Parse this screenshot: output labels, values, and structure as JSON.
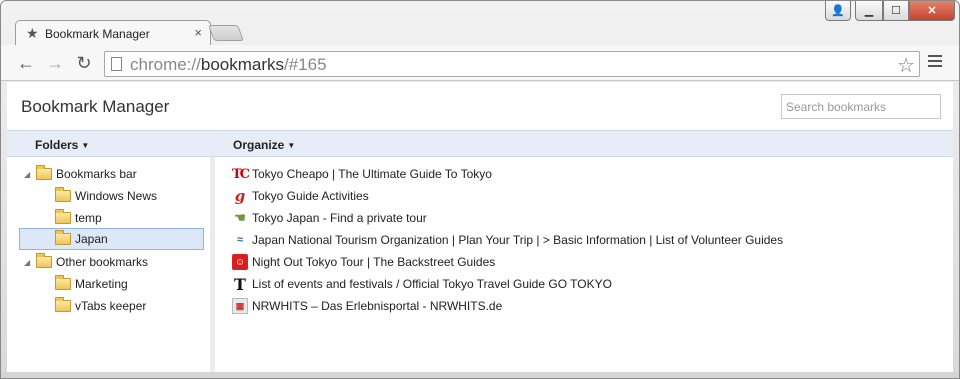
{
  "tab": {
    "title": "Bookmark Manager",
    "star_icon": "star-icon",
    "close": "×"
  },
  "window_controls": {
    "user": "👤",
    "minimize": "▁",
    "maximize": "☐",
    "close": "✕"
  },
  "toolbar": {
    "back": "←",
    "forward": "→",
    "reload": "↻"
  },
  "omnibox": {
    "scheme": "chrome://",
    "host": "bookmarks",
    "path": "/#165",
    "star": "☆"
  },
  "page": {
    "title": "Bookmark Manager",
    "search_placeholder": "Search bookmarks"
  },
  "bar": {
    "folders_label": "Folders",
    "organize_label": "Organize",
    "caret": "▼"
  },
  "tree": [
    {
      "label": "Bookmarks bar",
      "twisty": "◢",
      "level": 0
    },
    {
      "label": "Windows News",
      "twisty": "",
      "level": 1
    },
    {
      "label": "temp",
      "twisty": "",
      "level": 1
    },
    {
      "label": "Japan",
      "twisty": "",
      "level": 1,
      "selected": true
    },
    {
      "label": "Other bookmarks",
      "twisty": "◢",
      "level": 0
    },
    {
      "label": "Marketing",
      "twisty": "",
      "level": 1
    },
    {
      "label": "vTabs keeper",
      "twisty": "",
      "level": 1
    }
  ],
  "bookmarks": [
    {
      "icon": "tc",
      "icon_text": "TC",
      "title": "Tokyo Cheapo | The Ultimate Guide To Tokyo"
    },
    {
      "icon": "g",
      "icon_text": "g",
      "title": "Tokyo Guide Activities"
    },
    {
      "icon": "hand",
      "icon_text": "☚",
      "title": "Tokyo Japan - Find a private tour"
    },
    {
      "icon": "jnto",
      "icon_text": "≈",
      "title": "Japan National Tourism Organization | Plan Your Trip | > Basic Information | List of Volunteer Guides"
    },
    {
      "icon": "night",
      "icon_text": "☺",
      "title": "Night Out Tokyo Tour | The Backstreet Guides"
    },
    {
      "icon": "tt",
      "icon_text": "T",
      "title": "List of events and festivals / Official Tokyo Travel Guide GO TOKYO"
    },
    {
      "icon": "nrw",
      "icon_text": "▦",
      "title": "NRWHITS – Das Erlebnisportal - NRWHITS.de"
    }
  ]
}
